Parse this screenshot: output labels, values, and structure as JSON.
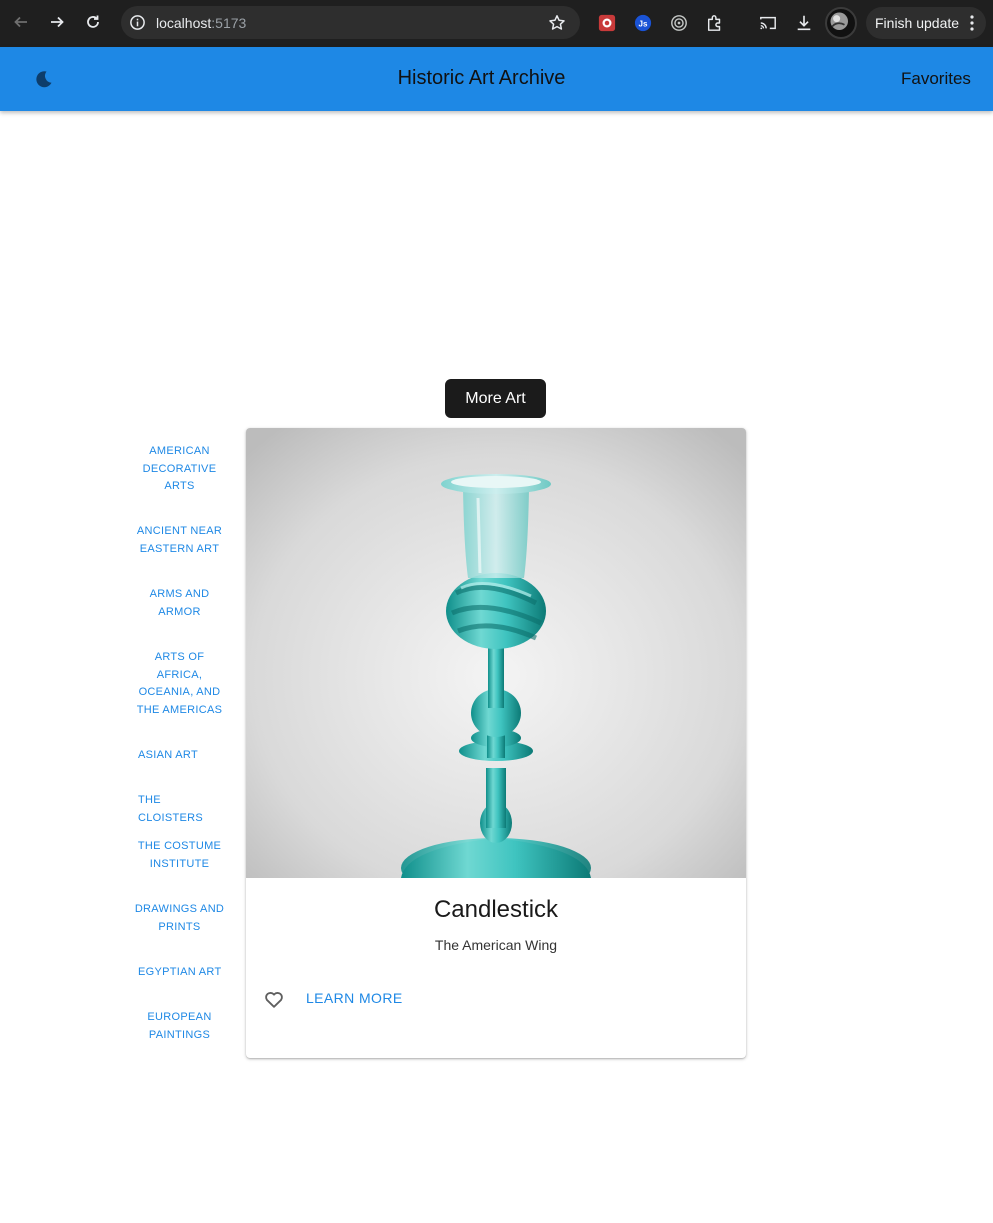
{
  "browser": {
    "url_host": "localhost",
    "url_port": ":5173",
    "finish_update_label": "Finish update"
  },
  "appbar": {
    "title": "Historic Art Archive",
    "favorites_label": "Favorites"
  },
  "more_art_label": "More Art",
  "departments": [
    "American Decorative Arts",
    "Ancient Near Eastern Art",
    "Arms and Armor",
    "Arts of Africa, Oceania, and the Americas",
    "Asian Art",
    "The Cloisters",
    "The Costume Institute",
    "Drawings and Prints",
    "Egyptian Art",
    "European Paintings"
  ],
  "card": {
    "title": "Candlestick",
    "department": "The American Wing",
    "learn_more_label": "Learn More"
  },
  "colors": {
    "appbar": "#1e88e5",
    "accent": "#1e88e5",
    "button_dark": "#1b1b1b",
    "glass": "#3fc4c0"
  },
  "icons": {
    "theme_toggle": "moon-icon",
    "favorite": "heart-outline-icon"
  }
}
